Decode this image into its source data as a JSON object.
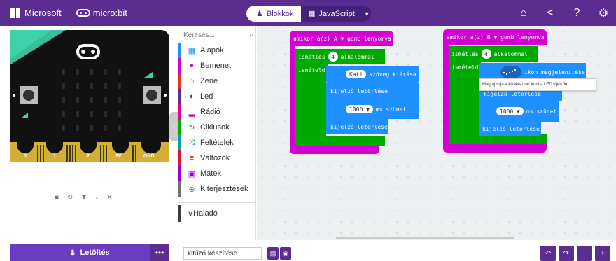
{
  "header": {
    "microsoft_label": "Microsoft",
    "microbit_label": "micro:bit",
    "blocks_label": "Blokkok",
    "javascript_label": "JavaScript"
  },
  "simulator": {
    "pins": [
      "0",
      "1",
      "2",
      "3V",
      "GND"
    ],
    "button_a": "A",
    "button_b": "B"
  },
  "toolbox": {
    "search_placeholder": "Keresés...",
    "categories": [
      {
        "label": "Alapok",
        "color": "#1e90ff"
      },
      {
        "label": "Bemenet",
        "color": "#d400d4"
      },
      {
        "label": "Zene",
        "color": "#e63022"
      },
      {
        "label": "Led",
        "color": "#5c2d91"
      },
      {
        "label": "Rádió",
        "color": "#e3008c"
      },
      {
        "label": "Ciklusok",
        "color": "#00aa00"
      },
      {
        "label": "Feltételek",
        "color": "#00a4a6"
      },
      {
        "label": "Változók",
        "color": "#dc143c"
      },
      {
        "label": "Matek",
        "color": "#9400d3"
      },
      {
        "label": "Kiterjesztések",
        "color": "#717171"
      }
    ],
    "advanced": "Haladó"
  },
  "workspace": {
    "script_a": {
      "event": "amikor a(z)",
      "button": "A ▼",
      "event_tail": "gomb lenyomva",
      "repeat": "ismétlés",
      "repeat_count": "4",
      "repeat_tail": "alkalommal",
      "do": "ismételd",
      "show_string_value": "Kati",
      "show_string": "szöveg kiírása",
      "clear1": "kijelző letörlése",
      "pause_value": "1000 ▼",
      "pause_tail": "ms szünet",
      "clear2": "kijelző letörlése"
    },
    "script_b": {
      "event": "amikor a(z)",
      "button": "B ▼",
      "event_tail": "gomb lenyomva",
      "repeat": "ismétlés",
      "repeat_count": "4",
      "repeat_tail": "alkalommal",
      "do": "ismételd",
      "show_icon": "ikon megjelenítése",
      "clear1": "kijelző letörlése",
      "pause_value": "1000 ▼",
      "pause_tail": "ms szünet",
      "clear2": "kijelző letörlése"
    },
    "tooltip": "Megrajzolja a kiválasztott ikont a LED kijelzőn"
  },
  "bottom": {
    "download": "Letöltés",
    "project_name": "kitűző készítése"
  }
}
